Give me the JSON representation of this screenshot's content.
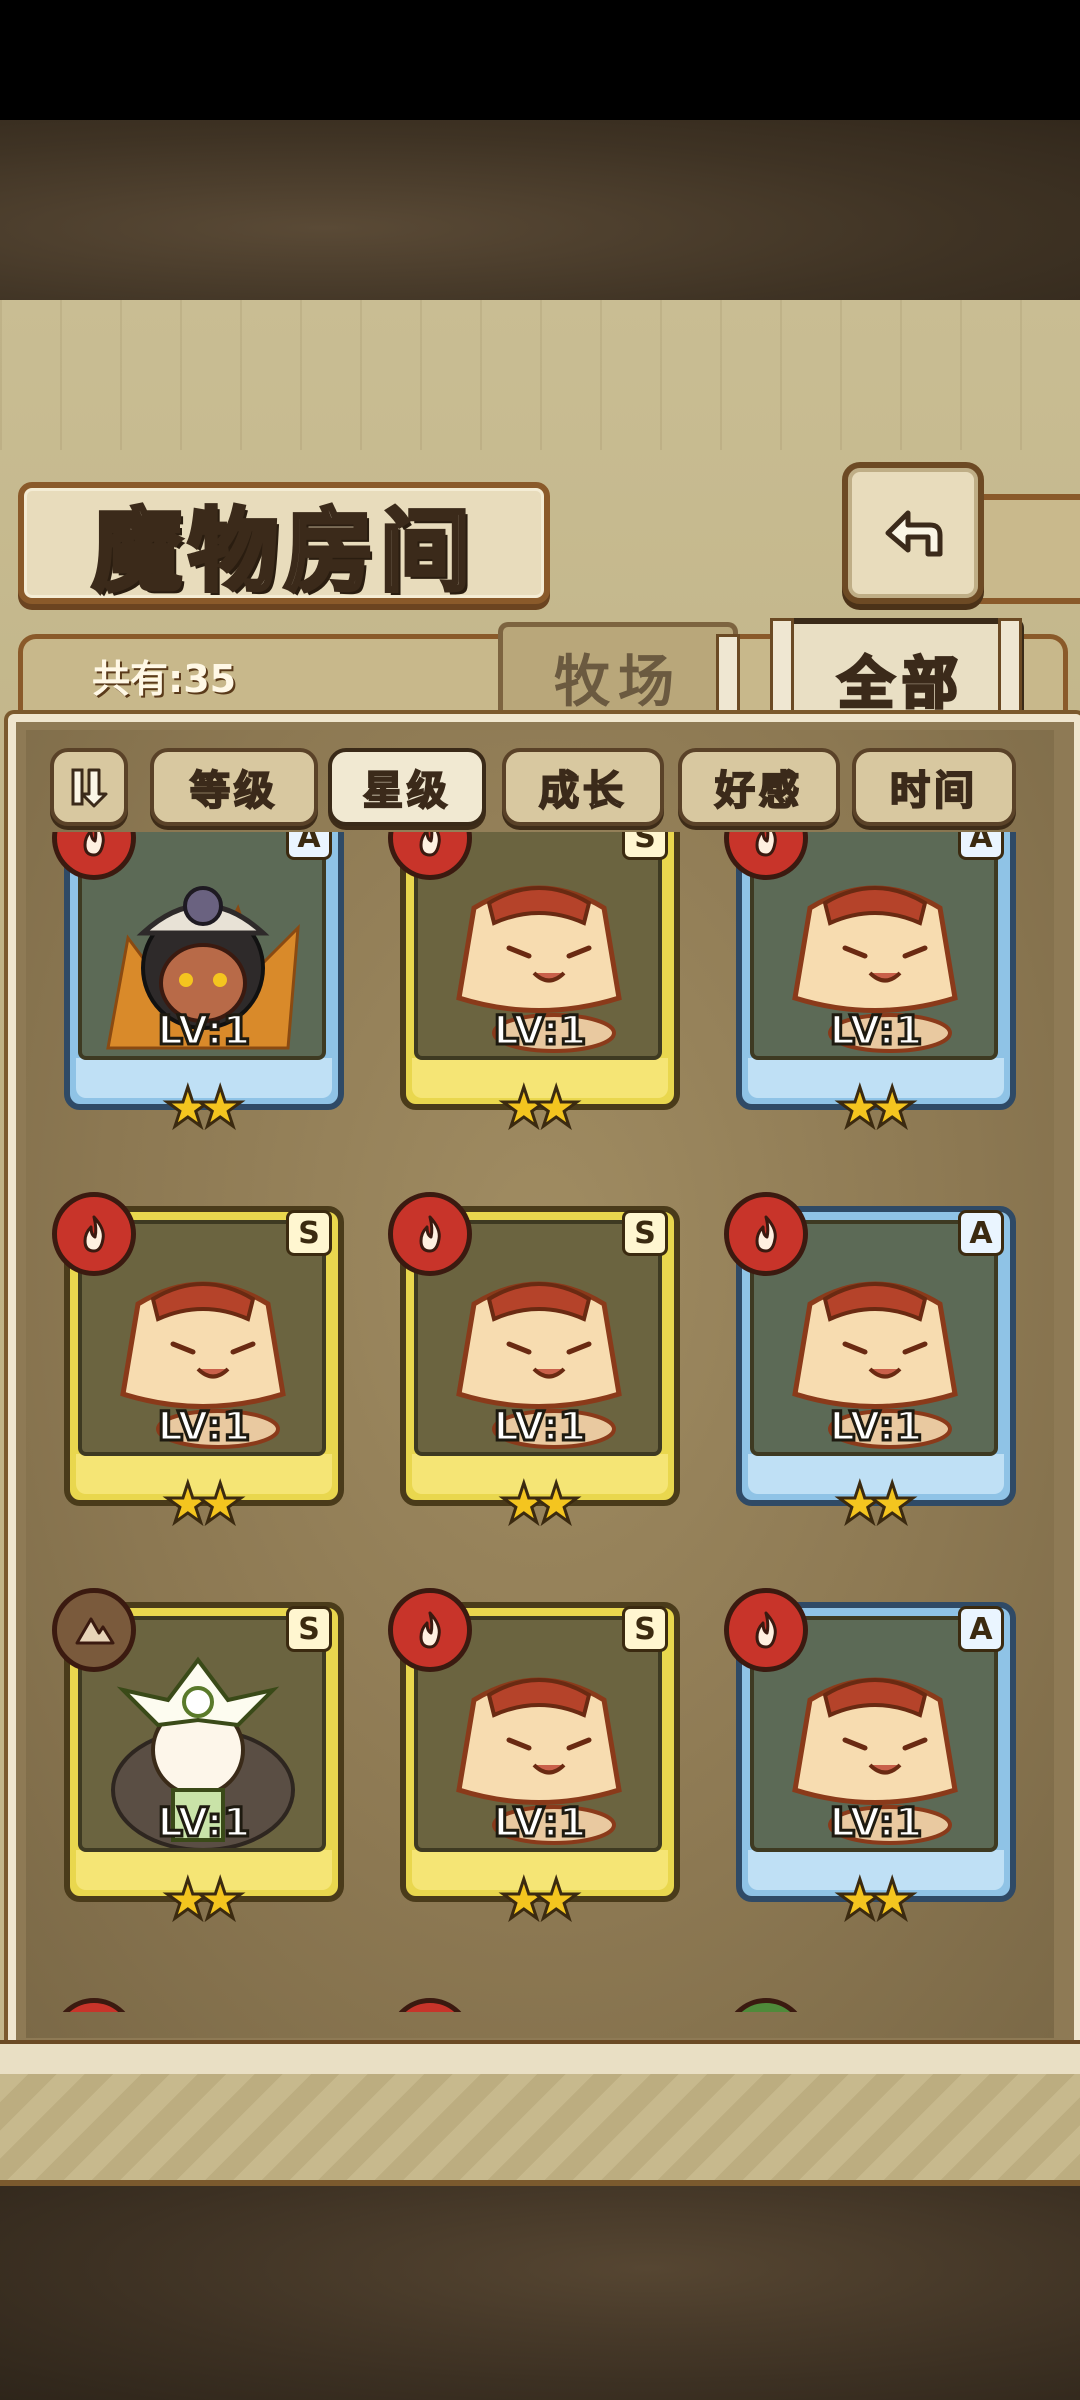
{
  "header": {
    "title": "魔物房间",
    "back_icon": "back-arrow-icon"
  },
  "panel": {
    "count_label": "共有:35",
    "tabs": [
      {
        "label": "牧场",
        "active": false
      },
      {
        "label": "全部",
        "active": true
      }
    ],
    "filters": [
      {
        "label": "等级",
        "active": false
      },
      {
        "label": "星级",
        "active": true
      },
      {
        "label": "成长",
        "active": false
      },
      {
        "label": "好感",
        "active": false
      },
      {
        "label": "时间",
        "active": false
      }
    ]
  },
  "cards": [
    {
      "element": "fire",
      "rank": "A",
      "frame": "blue",
      "level": "LV:1",
      "stars": 2,
      "creature": "miner-girl"
    },
    {
      "element": "fire",
      "rank": "S",
      "frame": "gold",
      "level": "LV:1",
      "stars": 2,
      "creature": "pudding"
    },
    {
      "element": "fire",
      "rank": "A",
      "frame": "blue",
      "level": "LV:1",
      "stars": 2,
      "creature": "pudding"
    },
    {
      "element": "fire",
      "rank": "S",
      "frame": "gold",
      "level": "LV:1",
      "stars": 2,
      "creature": "pudding"
    },
    {
      "element": "fire",
      "rank": "S",
      "frame": "gold",
      "level": "LV:1",
      "stars": 2,
      "creature": "pudding"
    },
    {
      "element": "fire",
      "rank": "A",
      "frame": "blue",
      "level": "LV:1",
      "stars": 2,
      "creature": "pudding"
    },
    {
      "element": "earth",
      "rank": "S",
      "frame": "gold",
      "level": "LV:1",
      "stars": 2,
      "creature": "flower-girl"
    },
    {
      "element": "fire",
      "rank": "S",
      "frame": "gold",
      "level": "LV:1",
      "stars": 2,
      "creature": "pudding"
    },
    {
      "element": "fire",
      "rank": "A",
      "frame": "blue",
      "level": "LV:1",
      "stars": 2,
      "creature": "pudding"
    }
  ],
  "colors": {
    "gold_frame": "#e9d74e",
    "blue_frame": "#8fc3e6",
    "fire_badge": "#c8342a",
    "star": "#f4c51f"
  }
}
